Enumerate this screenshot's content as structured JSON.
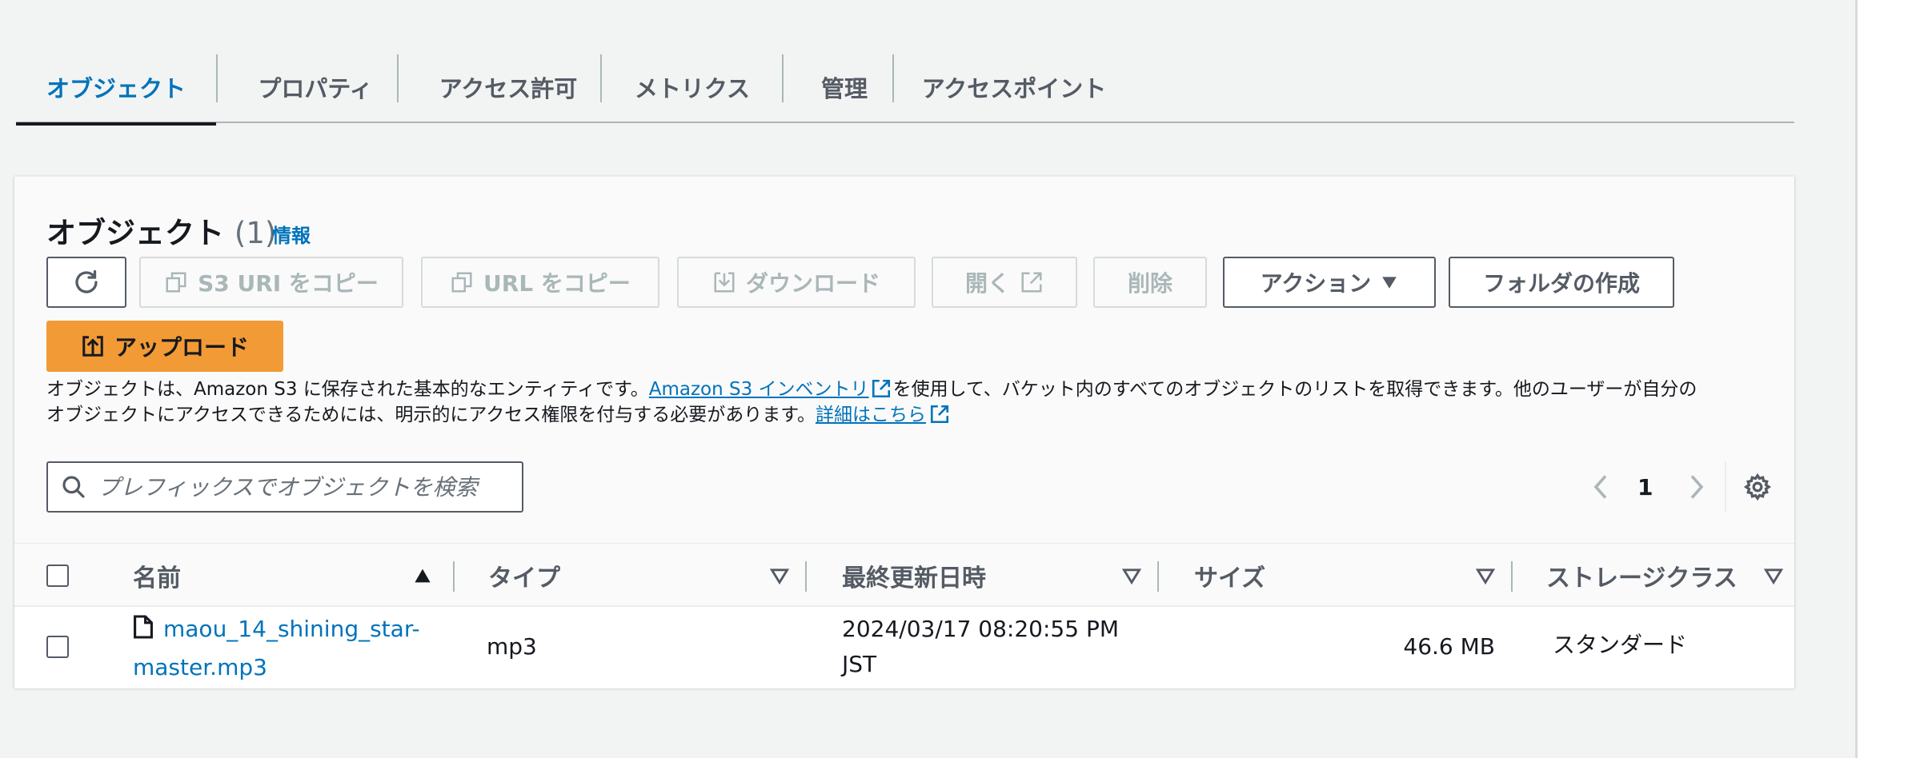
{
  "tabs": [
    "オブジェクト",
    "プロパティ",
    "アクセス許可",
    "メトリクス",
    "管理",
    "アクセスポイント"
  ],
  "active_tab": "オブジェクト",
  "panel": {
    "title": "オブジェクト",
    "count": "(1)",
    "info": "情報"
  },
  "toolbar": {
    "refresh_icon": "refresh-icon",
    "copy_s3_uri": "S3 URI をコピー",
    "copy_url": "URL をコピー",
    "download": "ダウンロード",
    "open": "開く",
    "delete": "削除",
    "actions": "アクション",
    "create_folder": "フォルダの作成",
    "upload": "アップロード"
  },
  "description": {
    "part1": "オブジェクトは、Amazon S3 に保存された基本的なエンティティです。",
    "link1": "Amazon S3 インベントリ",
    "part2": "を使用して、バケット内のすべてのオブジェクトのリストを取得できます。他のユーザーが自分の",
    "part3": "オブジェクトにアクセスできるためには、明示的にアクセス権限を付与する必要があります。",
    "link2": "詳細はこちら"
  },
  "search": {
    "placeholder": "プレフィックスでオブジェクトを検索"
  },
  "pagination": {
    "current_page": "1"
  },
  "table": {
    "columns": [
      "名前",
      "タイプ",
      "最終更新日時",
      "サイズ",
      "ストレージクラス"
    ],
    "rows": [
      {
        "name_line1": "maou_14_shining_star-",
        "name_line2": "master.mp3",
        "type": "mp3",
        "modified_line1": "2024/03/17 08:20:55 PM",
        "modified_line2": "JST",
        "size": "46.6 MB",
        "storage_class": "スタンダード"
      }
    ]
  },
  "colors": {
    "accent": "#0073bb",
    "primary_button": "#f29a35",
    "text": "#16191f",
    "muted": "#545b64"
  }
}
